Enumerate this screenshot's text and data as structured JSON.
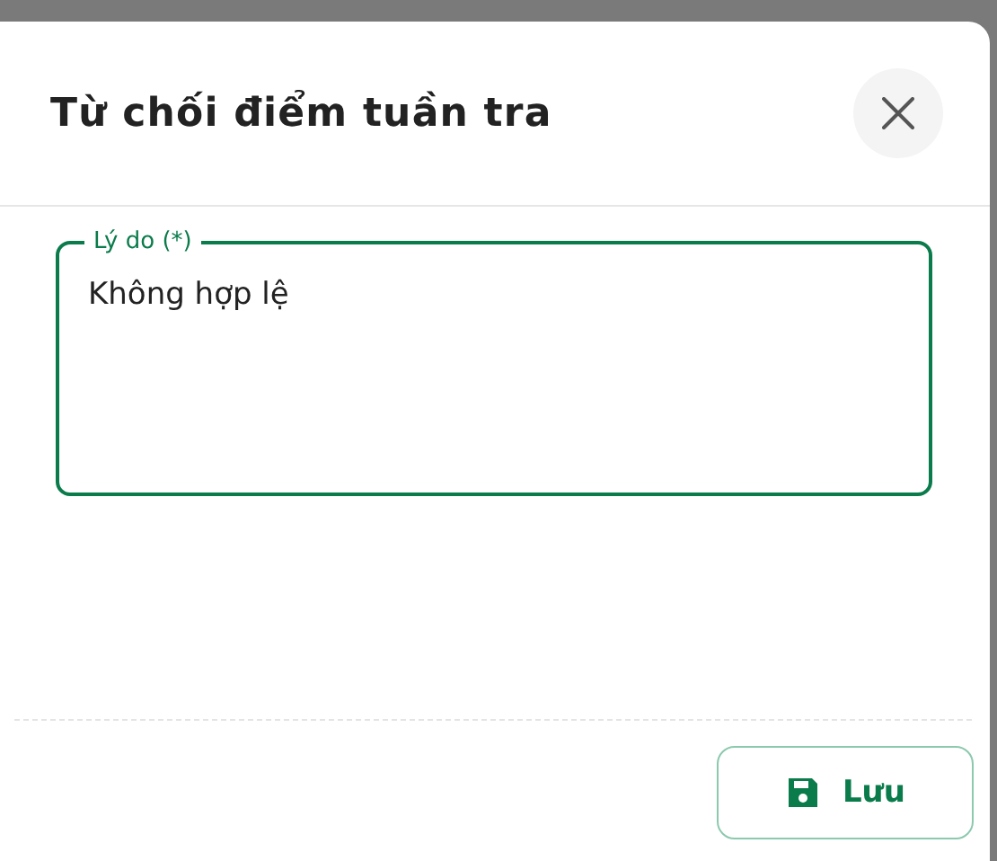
{
  "dialog": {
    "title": "Từ chối điểm tuần tra"
  },
  "reason_field": {
    "label": "Lý do (*)",
    "value": "Không hợp lệ"
  },
  "buttons": [
    {
      "label": "Lưu",
      "kind": "save"
    }
  ]
}
